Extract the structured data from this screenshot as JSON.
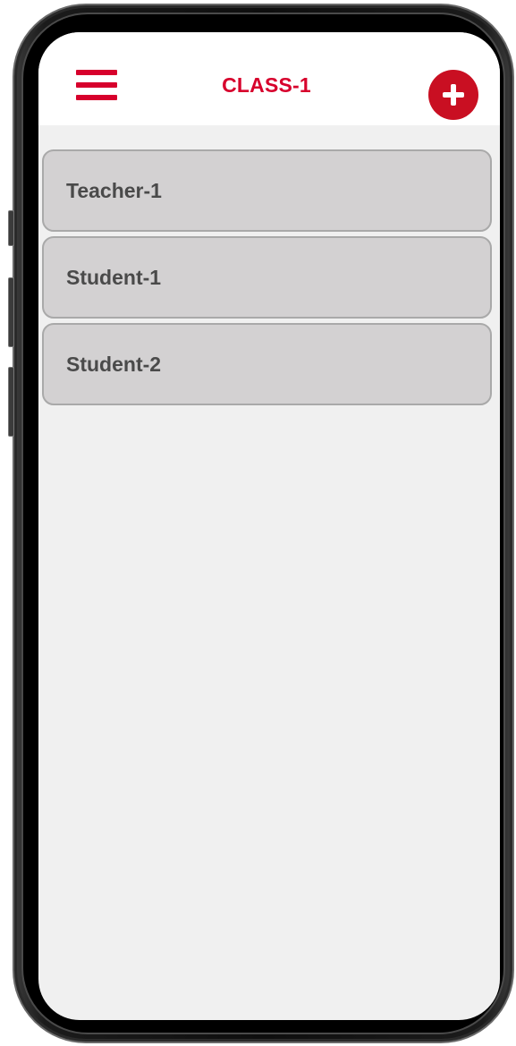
{
  "header": {
    "title": "CLASS-1",
    "menu_icon": "hamburger-menu-icon",
    "add_icon": "plus-circle-icon"
  },
  "members": [
    {
      "label": "Teacher-1"
    },
    {
      "label": "Student-1"
    },
    {
      "label": "Student-2"
    }
  ],
  "colors": {
    "accent": "#d7002c",
    "add_button": "#c90f22",
    "item_background": "#d3d1d2",
    "item_border": "#a9a9a9",
    "item_text": "#4a4a4a",
    "screen_background": "#f0f0f0"
  }
}
